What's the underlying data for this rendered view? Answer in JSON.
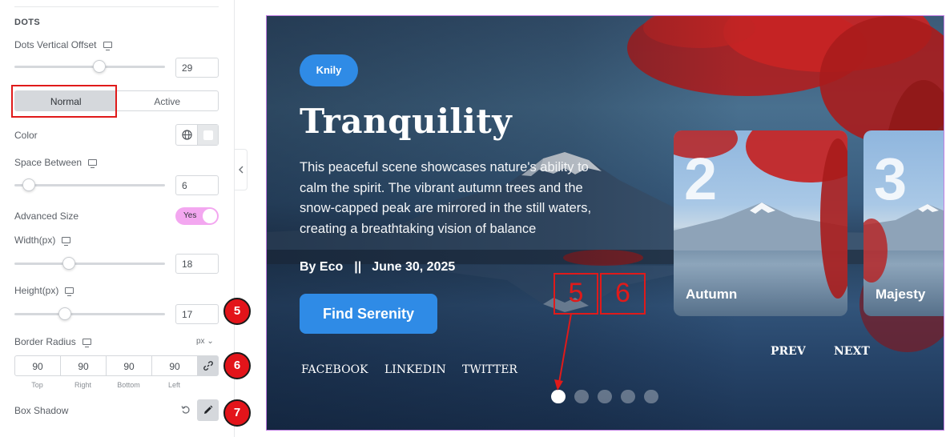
{
  "panel": {
    "section_title": "DOTS",
    "vertical_offset": {
      "label": "Dots Vertical Offset",
      "value": "29",
      "slider_fraction": 0.57
    },
    "state_tabs": [
      {
        "label": "Normal",
        "active": true
      },
      {
        "label": "Active",
        "active": false
      }
    ],
    "color": {
      "label": "Color",
      "swatch": "#ffffff"
    },
    "space_between": {
      "label": "Space Between",
      "value": "6",
      "slider_fraction": 0.06
    },
    "advanced_size": {
      "label": "Advanced Size",
      "toggle_label": "Yes",
      "on": true
    },
    "width": {
      "label": "Width(px)",
      "value": "18",
      "slider_fraction": 0.35
    },
    "height": {
      "label": "Height(px)",
      "value": "17",
      "slider_fraction": 0.32
    },
    "border_radius": {
      "label": "Border Radius",
      "unit": "px",
      "values": [
        "90",
        "90",
        "90",
        "90"
      ],
      "sides": [
        "Top",
        "Right",
        "Bottom",
        "Left"
      ]
    },
    "box_shadow": {
      "label": "Box Shadow"
    },
    "badges": [
      "5",
      "6",
      "7"
    ]
  },
  "slide": {
    "tag": "Knily",
    "title": "Tranquility",
    "description": "This peaceful scene showcases nature's ability to calm the spirit. The vibrant autumn trees and the snow-capped peak are mirrored in the still waters, creating a breathtaking vision of balance",
    "author": "By Eco",
    "separator": "||",
    "date": "June 30, 2025",
    "cta": "Find Serenity",
    "social": [
      "FACEBOOK",
      "LINKEDIN",
      "TWITTER"
    ],
    "cards": [
      {
        "number": "2",
        "caption": "Autumn"
      },
      {
        "number": "3",
        "caption": "Majesty"
      }
    ],
    "prev": "PREV",
    "next": "NEXT",
    "dots_total": 5,
    "dots_active_index": 0,
    "callouts": [
      "5",
      "6"
    ]
  },
  "colors": {
    "accent_blue": "#2f8be6",
    "callout_red": "#e01a1a",
    "toggle_pink": "#f3a7f0",
    "frame_purple": "#c27fe4"
  }
}
